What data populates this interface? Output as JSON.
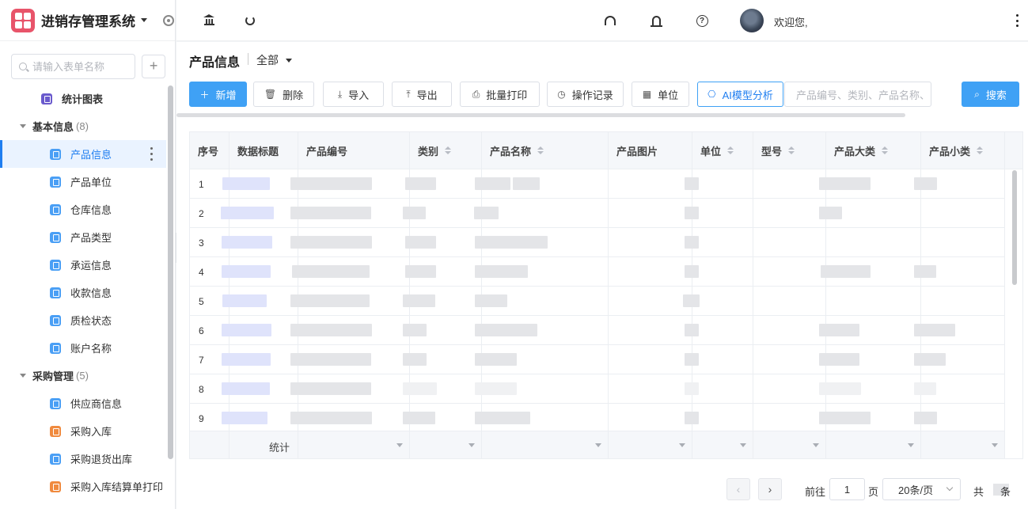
{
  "app": {
    "title": "进销存管理系统"
  },
  "sidebar": {
    "search_placeholder": "请输入表单名称",
    "top_item": "统计图表",
    "groups": [
      {
        "label": "基本信息",
        "count": "(8)",
        "items": [
          "产品信息",
          "产品单位",
          "仓库信息",
          "产品类型",
          "承运信息",
          "收款信息",
          "质检状态",
          "账户名称"
        ]
      },
      {
        "label": "采购管理",
        "count": "(5)",
        "items": [
          "供应商信息",
          "采购入库",
          "采购退货出库",
          "采购入库结算单打印"
        ]
      }
    ]
  },
  "header": {
    "welcome": "欢迎您,"
  },
  "page": {
    "title": "产品信息",
    "scope": "全部"
  },
  "toolbar": {
    "add": "新增",
    "delete": "删除",
    "import": "导入",
    "export": "导出",
    "batch_print": "批量打印",
    "log": "操作记录",
    "unit": "单位",
    "ai": "AI模型分析",
    "keyword_placeholder": "产品编号、类别、产品名称、",
    "search": "搜索"
  },
  "table": {
    "columns": [
      "序号",
      "数据标题",
      "产品编号",
      "类别",
      "产品名称",
      "产品图片",
      "单位",
      "型号",
      "产品大类",
      "产品小类"
    ],
    "rows": [
      "1",
      "2",
      "3",
      "4",
      "5",
      "6",
      "7",
      "8",
      "9"
    ],
    "footer_label": "统计"
  },
  "pager": {
    "goto": "前往",
    "page_value": "1",
    "page_unit": "页",
    "page_size": "20条/页",
    "total_prefix": "共",
    "total_suffix": "条"
  },
  "colors": {
    "primary": "#3fa1f5",
    "accent": "#1f7ef0",
    "logo": "#e8546a"
  }
}
